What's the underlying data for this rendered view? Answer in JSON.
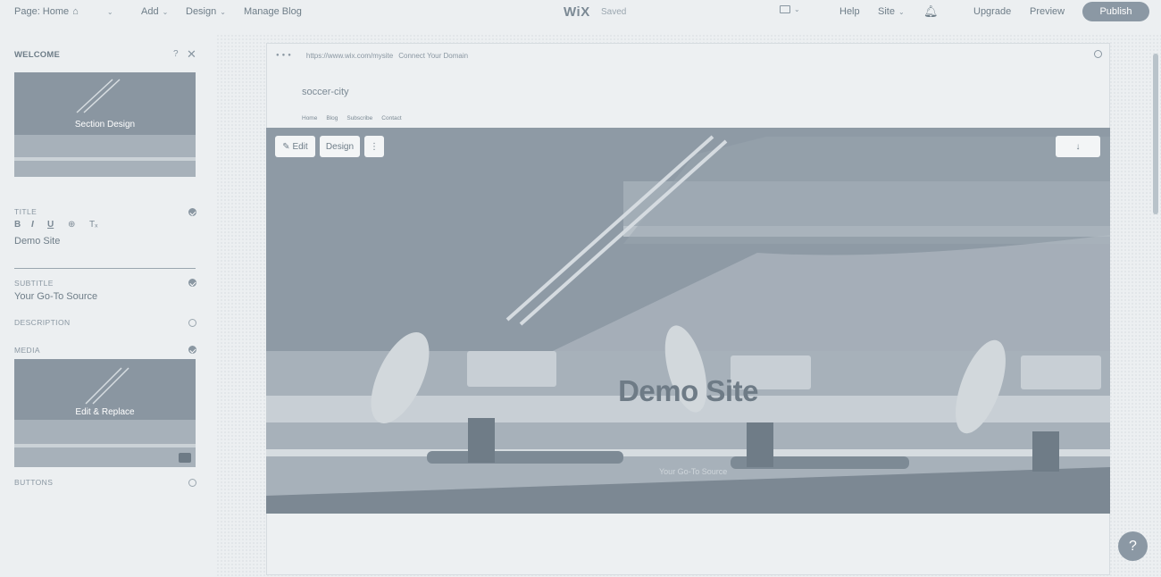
{
  "topbar": {
    "page_label": "Page: Home",
    "add": "Add",
    "design": "Design",
    "manage_blog": "Manage Blog",
    "brand": "WiX",
    "saved": "Saved",
    "help": "Help",
    "site": "Site",
    "upgrade": "Upgrade",
    "preview": "Preview",
    "publish": "Publish"
  },
  "panel": {
    "title": "WELCOME",
    "help": "?",
    "section_design": "Section Design",
    "title_label": "TITLE",
    "title_value": "Demo Site",
    "subtitle_label": "SUBTITLE",
    "subtitle_value": "Your Go-To Source",
    "description_label": "DESCRIPTION",
    "media_label": "MEDIA",
    "edit_replace": "Edit & Replace",
    "buttons_label": "BUTTONS",
    "format": {
      "bold": "B",
      "italic": "I",
      "underline": "U",
      "link": "⊕",
      "clear": "Tₓ"
    }
  },
  "site": {
    "url": "https://www.wix.com/mysite",
    "connect": "Connect Your Domain",
    "name": "soccer-city",
    "menu": [
      "Home",
      "Blog",
      "Subscribe",
      "Contact"
    ]
  },
  "hero": {
    "edit": "✎ Edit",
    "design": "Design",
    "more": "⋮",
    "down": "↓",
    "title": "Demo Site",
    "subtitle": "Your Go-To Source"
  },
  "help_fab": "?",
  "colors": {
    "accent": "#8b98a4",
    "background": "#eceff1"
  }
}
